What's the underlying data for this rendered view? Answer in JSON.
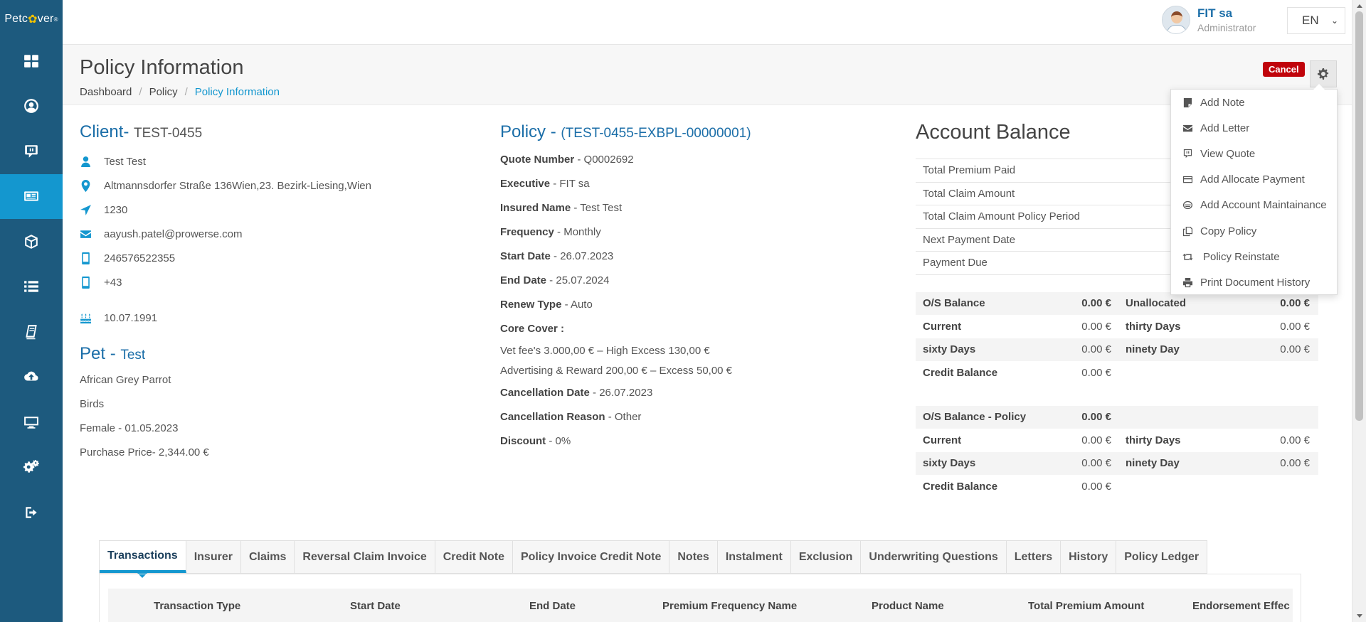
{
  "brand": {
    "logo_prefix": "Petc",
    "logo_paw": "✿",
    "logo_suffix": "ver",
    "logo_mark": "®"
  },
  "sidebar": {
    "items": [
      {
        "icon": "dashboard-icon"
      },
      {
        "icon": "user-circle-icon"
      },
      {
        "icon": "chat-icon"
      },
      {
        "icon": "policy-card-icon",
        "active": true
      },
      {
        "icon": "box-icon"
      },
      {
        "icon": "list-icon"
      },
      {
        "icon": "book-icon"
      },
      {
        "icon": "cloud-upload-icon"
      },
      {
        "icon": "monitor-icon"
      },
      {
        "icon": "settings-icon"
      },
      {
        "icon": "logout-icon"
      }
    ]
  },
  "user": {
    "name": "FIT sa",
    "role": "Administrator"
  },
  "language": {
    "value": "EN"
  },
  "header": {
    "title": "Policy Information",
    "breadcrumb": [
      "Dashboard",
      "Policy",
      "Policy Information"
    ],
    "cancel_label": "Cancel"
  },
  "menu": {
    "items": [
      {
        "label": "Add Note",
        "icon": "note-icon"
      },
      {
        "label": "Add Letter",
        "icon": "envelope-icon"
      },
      {
        "label": "View Quote",
        "icon": "quote-icon"
      },
      {
        "label": "Add Allocate Payment",
        "icon": "credit-card-icon"
      },
      {
        "label": "Add Account Maintainance",
        "icon": "coins-icon"
      },
      {
        "label": "Copy Policy",
        "icon": "copy-icon"
      },
      {
        "label": "Policy Reinstate",
        "icon": "retweet-icon"
      },
      {
        "label": "Print Document History",
        "icon": "print-icon"
      }
    ]
  },
  "client": {
    "heading": "Client-",
    "id": "TEST-0455",
    "name": "Test Test",
    "address": "Altmannsdorfer Straße 136Wien,23. Bezirk-Liesing,Wien",
    "postcode": "1230",
    "email": "aayush.patel@prowerse.com",
    "phone": "246576522355",
    "phone2": "+43",
    "dob": "10.07.1991"
  },
  "pet": {
    "heading": "Pet -",
    "name": "Test",
    "breed": "African Grey Parrot",
    "type": "Birds",
    "gender_dob": "Female - 01.05.2023",
    "purchase_price": "Purchase Price- 2,344.00 €"
  },
  "policy": {
    "heading": "Policy -",
    "number": "(TEST-0455-EXBPL-00000001)",
    "fields": [
      {
        "label": "Quote Number",
        "value": "Q0002692"
      },
      {
        "label": "Executive",
        "value": "FIT sa"
      },
      {
        "label": "Insured Name",
        "value": "Test Test"
      },
      {
        "label": "Frequency",
        "value": "Monthly"
      },
      {
        "label": "Start Date",
        "value": "26.07.2023"
      },
      {
        "label": "End Date",
        "value": "25.07.2024"
      },
      {
        "label": "Renew Type",
        "value": "Auto"
      }
    ],
    "core_cover_label": "Core Cover :",
    "core_cover": [
      "Vet fee's 3.000,00 € – High Excess 130,00 €",
      "Advertising & Reward 200,00 € – Excess 50,00 €"
    ],
    "fields2": [
      {
        "label": "Cancellation Date",
        "value": "26.07.2023"
      },
      {
        "label": "Cancellation Reason",
        "value": "Other"
      },
      {
        "label": "Discount",
        "value": "0%"
      }
    ]
  },
  "account": {
    "title": "Account Balance",
    "items": [
      "Total Premium Paid",
      "Total Claim Amount",
      "Total Claim Amount Policy Period",
      "Next Payment Date",
      "Payment Due"
    ],
    "balance": [
      {
        "l1": "O/S Balance",
        "v1": "0.00 €",
        "l2": "Unallocated",
        "v2": "0.00 €"
      },
      {
        "l1": "Current",
        "v1": "0.00 €",
        "l2": "thirty Days",
        "v2": "0.00 €"
      },
      {
        "l1": "sixty Days",
        "v1": "0.00 €",
        "l2": "ninety Day",
        "v2": "0.00 €"
      },
      {
        "l1": "Credit Balance",
        "v1": "0.00 €"
      }
    ],
    "policy_balance": [
      {
        "l1": "O/S Balance - Policy",
        "v1": "0.00 €"
      },
      {
        "l1": "Current",
        "v1": "0.00 €",
        "l2": "thirty Days",
        "v2": "0.00 €"
      },
      {
        "l1": "sixty Days",
        "v1": "0.00 €",
        "l2": "ninety Day",
        "v2": "0.00 €"
      },
      {
        "l1": "Credit Balance",
        "v1": "0.00 €"
      }
    ]
  },
  "tabs": [
    "Transactions",
    "Insurer",
    "Claims",
    "Reversal Claim Invoice",
    "Credit Note",
    "Policy Invoice Credit Note",
    "Notes",
    "Instalment",
    "Exclusion",
    "Underwriting Questions",
    "Letters",
    "History",
    "Policy Ledger"
  ],
  "transactions": {
    "columns": [
      "Transaction Type",
      "Start Date",
      "End Date",
      "Premium Frequency Name",
      "Product Name",
      "Total Premium Amount",
      "Endorsement Effec"
    ]
  }
}
